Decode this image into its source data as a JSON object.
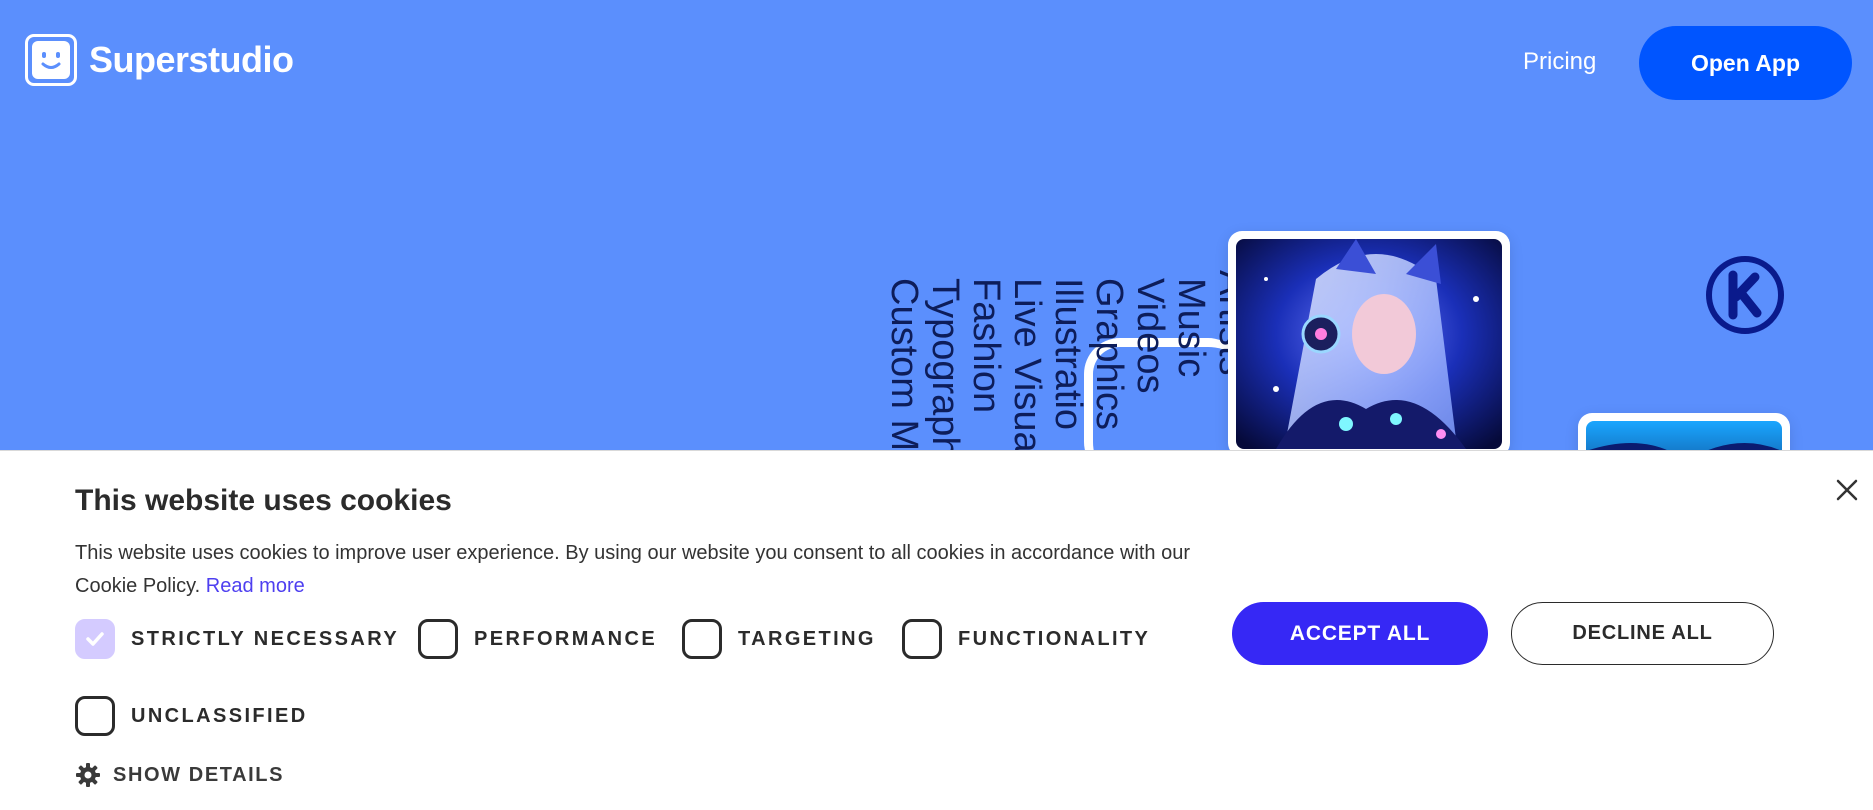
{
  "header": {
    "brand": "Superstudio",
    "nav_pricing": "Pricing",
    "open_app": "Open App"
  },
  "hero": {
    "vertical_words": [
      "Custom M",
      "Typograph",
      "Fashion",
      "Live Visua",
      "Illustratio",
      "Graphics",
      "Videos",
      "Music",
      "Artists"
    ],
    "k_logo_letter": "K"
  },
  "cookie_banner": {
    "title": "This website uses cookies",
    "description": "This website uses cookies to improve user experience. By using our website you consent to all cookies in accordance with our Cookie Policy.",
    "read_more": "Read more",
    "options": [
      {
        "label": "STRICTLY NECESSARY",
        "checked": true
      },
      {
        "label": "PERFORMANCE",
        "checked": false
      },
      {
        "label": "TARGETING",
        "checked": false
      },
      {
        "label": "FUNCTIONALITY",
        "checked": false
      },
      {
        "label": "UNCLASSIFIED",
        "checked": false
      }
    ],
    "accept_all": "ACCEPT ALL",
    "decline_all": "DECLINE ALL",
    "show_details": "SHOW DETAILS",
    "close_icon": "close-icon",
    "gear_icon": "gear-icon"
  },
  "colors": {
    "hero_background": "#5b8ffd",
    "open_app_button": "#0055ff",
    "accept_button": "#3628f5",
    "link": "#4e3ff0",
    "checked_box": "#d4cbff",
    "vertical_text": "#0d1d5a"
  }
}
